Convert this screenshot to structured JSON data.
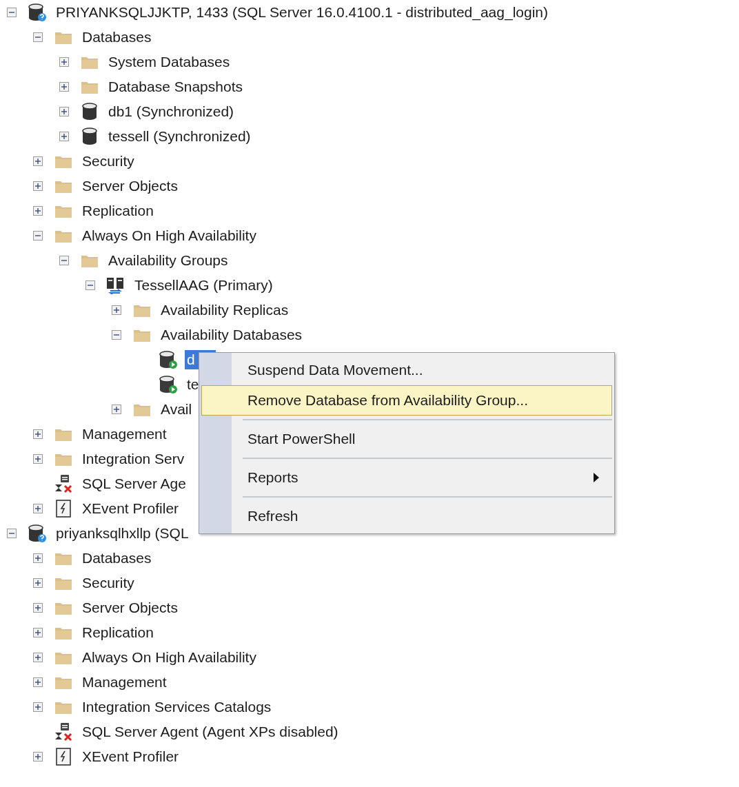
{
  "tree": [
    {
      "text": "PRIYANKSQLJJKTP, 1433 (SQL Server 16.0.4100.1 - distributed_aag_login)",
      "kind": "server",
      "expanded": true,
      "selected": false,
      "children": [
        {
          "text": "Databases",
          "kind": "folder",
          "expanded": true,
          "selected": false,
          "children": [
            {
              "text": "System Databases",
              "kind": "folder",
              "expanded": false,
              "selected": false
            },
            {
              "text": "Database Snapshots",
              "kind": "folder",
              "expanded": false,
              "selected": false
            },
            {
              "text": "db1 (Synchronized)",
              "kind": "database",
              "expanded": false,
              "selected": false
            },
            {
              "text": "tessell (Synchronized)",
              "kind": "database",
              "expanded": false,
              "selected": false
            }
          ]
        },
        {
          "text": "Security",
          "kind": "folder",
          "expanded": false,
          "selected": false
        },
        {
          "text": "Server Objects",
          "kind": "folder",
          "expanded": false,
          "selected": false
        },
        {
          "text": "Replication",
          "kind": "folder",
          "expanded": false,
          "selected": false
        },
        {
          "text": "Always On High Availability",
          "kind": "folder",
          "expanded": true,
          "selected": false,
          "children": [
            {
              "text": "Availability Groups",
              "kind": "folder",
              "expanded": true,
              "selected": false,
              "children": [
                {
                  "text": "TessellAAG (Primary)",
                  "kind": "group",
                  "expanded": true,
                  "selected": false,
                  "children": [
                    {
                      "text": "Availability Replicas",
                      "kind": "folder",
                      "expanded": false,
                      "selected": false
                    },
                    {
                      "text": "Availability Databases",
                      "kind": "folder",
                      "expanded": true,
                      "selected": false,
                      "children": [
                        {
                          "text": "d",
                          "kind": "replica-db",
                          "selected": true
                        },
                        {
                          "text": "te",
                          "kind": "replica-db",
                          "selected": false
                        }
                      ]
                    },
                    {
                      "text": "Avail",
                      "kind": "folder",
                      "expanded": false,
                      "selected": false
                    }
                  ]
                }
              ]
            }
          ]
        },
        {
          "text": "Management",
          "kind": "folder",
          "expanded": false,
          "selected": false
        },
        {
          "text": "Integration Serv",
          "kind": "folder",
          "expanded": false,
          "selected": false
        },
        {
          "text": "SQL Server Age",
          "kind": "agent",
          "selected": false
        },
        {
          "text": "XEvent Profiler",
          "kind": "xevent",
          "expanded": false,
          "selected": false
        }
      ]
    },
    {
      "text": "priyanksqlhxllp (SQL",
      "kind": "server",
      "expanded": true,
      "selected": false,
      "children": [
        {
          "text": "Databases",
          "kind": "folder",
          "expanded": false,
          "selected": false
        },
        {
          "text": "Security",
          "kind": "folder",
          "expanded": false,
          "selected": false
        },
        {
          "text": "Server Objects",
          "kind": "folder",
          "expanded": false,
          "selected": false
        },
        {
          "text": "Replication",
          "kind": "folder",
          "expanded": false,
          "selected": false
        },
        {
          "text": "Always On High Availability",
          "kind": "folder",
          "expanded": false,
          "selected": false
        },
        {
          "text": "Management",
          "kind": "folder",
          "expanded": false,
          "selected": false
        },
        {
          "text": "Integration Services Catalogs",
          "kind": "folder",
          "expanded": false,
          "selected": false
        },
        {
          "text": "SQL Server Agent (Agent XPs disabled)",
          "kind": "agent",
          "selected": false
        },
        {
          "text": "XEvent Profiler",
          "kind": "xevent",
          "expanded": false,
          "selected": false
        }
      ]
    }
  ],
  "context_menu": {
    "items": [
      {
        "kind": "item",
        "label": "Suspend Data Movement...",
        "selected": false
      },
      {
        "kind": "item",
        "label": "Remove Database from Availability Group...",
        "selected": true
      },
      {
        "kind": "separator"
      },
      {
        "kind": "item",
        "label": "Start PowerShell",
        "selected": false
      },
      {
        "kind": "separator"
      },
      {
        "kind": "submenu",
        "label": "Reports",
        "selected": false
      },
      {
        "kind": "separator"
      },
      {
        "kind": "item",
        "label": "Refresh",
        "selected": false
      }
    ]
  }
}
